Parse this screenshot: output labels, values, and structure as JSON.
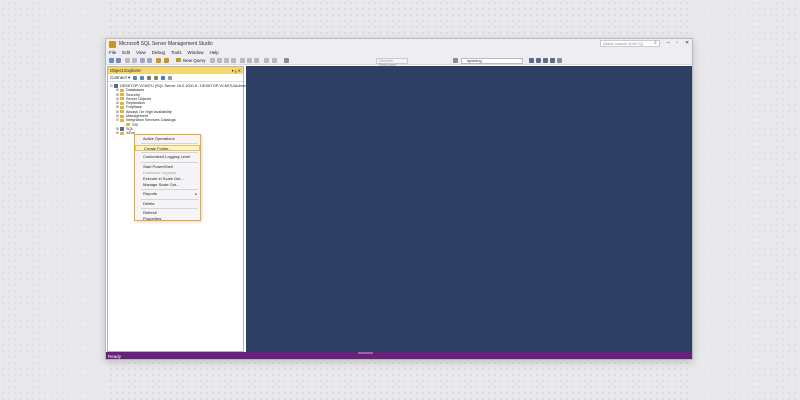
{
  "window": {
    "title": "Microsoft SQL Server Management Studio",
    "quick_launch_placeholder": "Quick Launch (Ctrl+Q)"
  },
  "menu": [
    "File",
    "Edit",
    "View",
    "Debug",
    "Tools",
    "Window",
    "Help"
  ],
  "toolbar": {
    "new_query_label": "New Query",
    "execute_dropdown": "Generic Debugger",
    "database_select": "spwning"
  },
  "object_explorer": {
    "title": "Object Explorer",
    "header_controls": "▾ ᵩ ✕",
    "connect_label": "Connect ▾",
    "tree": [
      {
        "label": "DESKTOP-VCMI7U (SQL Server 16.0.1000.6 - DESKTOP-VCMI7U\\Admin)",
        "exp": "⊟",
        "icon": "server",
        "indent": 0
      },
      {
        "label": "Databases",
        "exp": "⊞",
        "icon": "folder",
        "indent": 1
      },
      {
        "label": "Security",
        "exp": "⊞",
        "icon": "folder",
        "indent": 1
      },
      {
        "label": "Server Objects",
        "exp": "⊞",
        "icon": "folder",
        "indent": 1
      },
      {
        "label": "Replication",
        "exp": "⊞",
        "icon": "folder",
        "indent": 1
      },
      {
        "label": "PolyBase",
        "exp": "⊞",
        "icon": "folder",
        "indent": 1
      },
      {
        "label": "Always On High Availability",
        "exp": "⊞",
        "icon": "folder",
        "indent": 1
      },
      {
        "label": "Management",
        "exp": "⊞",
        "icon": "folder",
        "indent": 1
      },
      {
        "label": "Integration Services Catalogs",
        "exp": "⊟",
        "icon": "folder",
        "indent": 1
      },
      {
        "label": "SSI",
        "exp": "",
        "icon": "folder",
        "indent": 2
      },
      {
        "label": "SQL",
        "exp": "⊞",
        "icon": "server",
        "indent": 1
      },
      {
        "label": "XEve",
        "exp": "⊞",
        "icon": "folder",
        "indent": 1
      }
    ]
  },
  "context_menu": {
    "items": [
      {
        "label": "Active Operations",
        "disabled": false,
        "highlight": false
      },
      {
        "sep": true
      },
      {
        "label": "Create Folder...",
        "disabled": false,
        "highlight": true
      },
      {
        "sep": true
      },
      {
        "label": "Customized Logging Level",
        "disabled": false,
        "highlight": false
      },
      {
        "sep": true
      },
      {
        "label": "Start PowerShell",
        "disabled": false,
        "highlight": false
      },
      {
        "label": "Database Upgrade",
        "disabled": true,
        "highlight": false
      },
      {
        "label": "Execute in Scale Out...",
        "disabled": false,
        "highlight": false
      },
      {
        "label": "Manage Scale Out...",
        "disabled": false,
        "highlight": false
      },
      {
        "sep": true
      },
      {
        "label": "Reports",
        "disabled": false,
        "highlight": false,
        "submenu": true
      },
      {
        "sep": true
      },
      {
        "label": "Delete",
        "disabled": false,
        "highlight": false
      },
      {
        "sep": true
      },
      {
        "label": "Refresh",
        "disabled": false,
        "highlight": false
      },
      {
        "label": "Properties",
        "disabled": false,
        "highlight": false
      }
    ]
  },
  "status": {
    "text": "Ready"
  },
  "colors": {
    "accent": "#68217a",
    "main_bg": "#2d3f63",
    "highlight_border": "#f5a623"
  },
  "icons": {
    "submenu_arrow": "▸",
    "search": "⌕"
  }
}
